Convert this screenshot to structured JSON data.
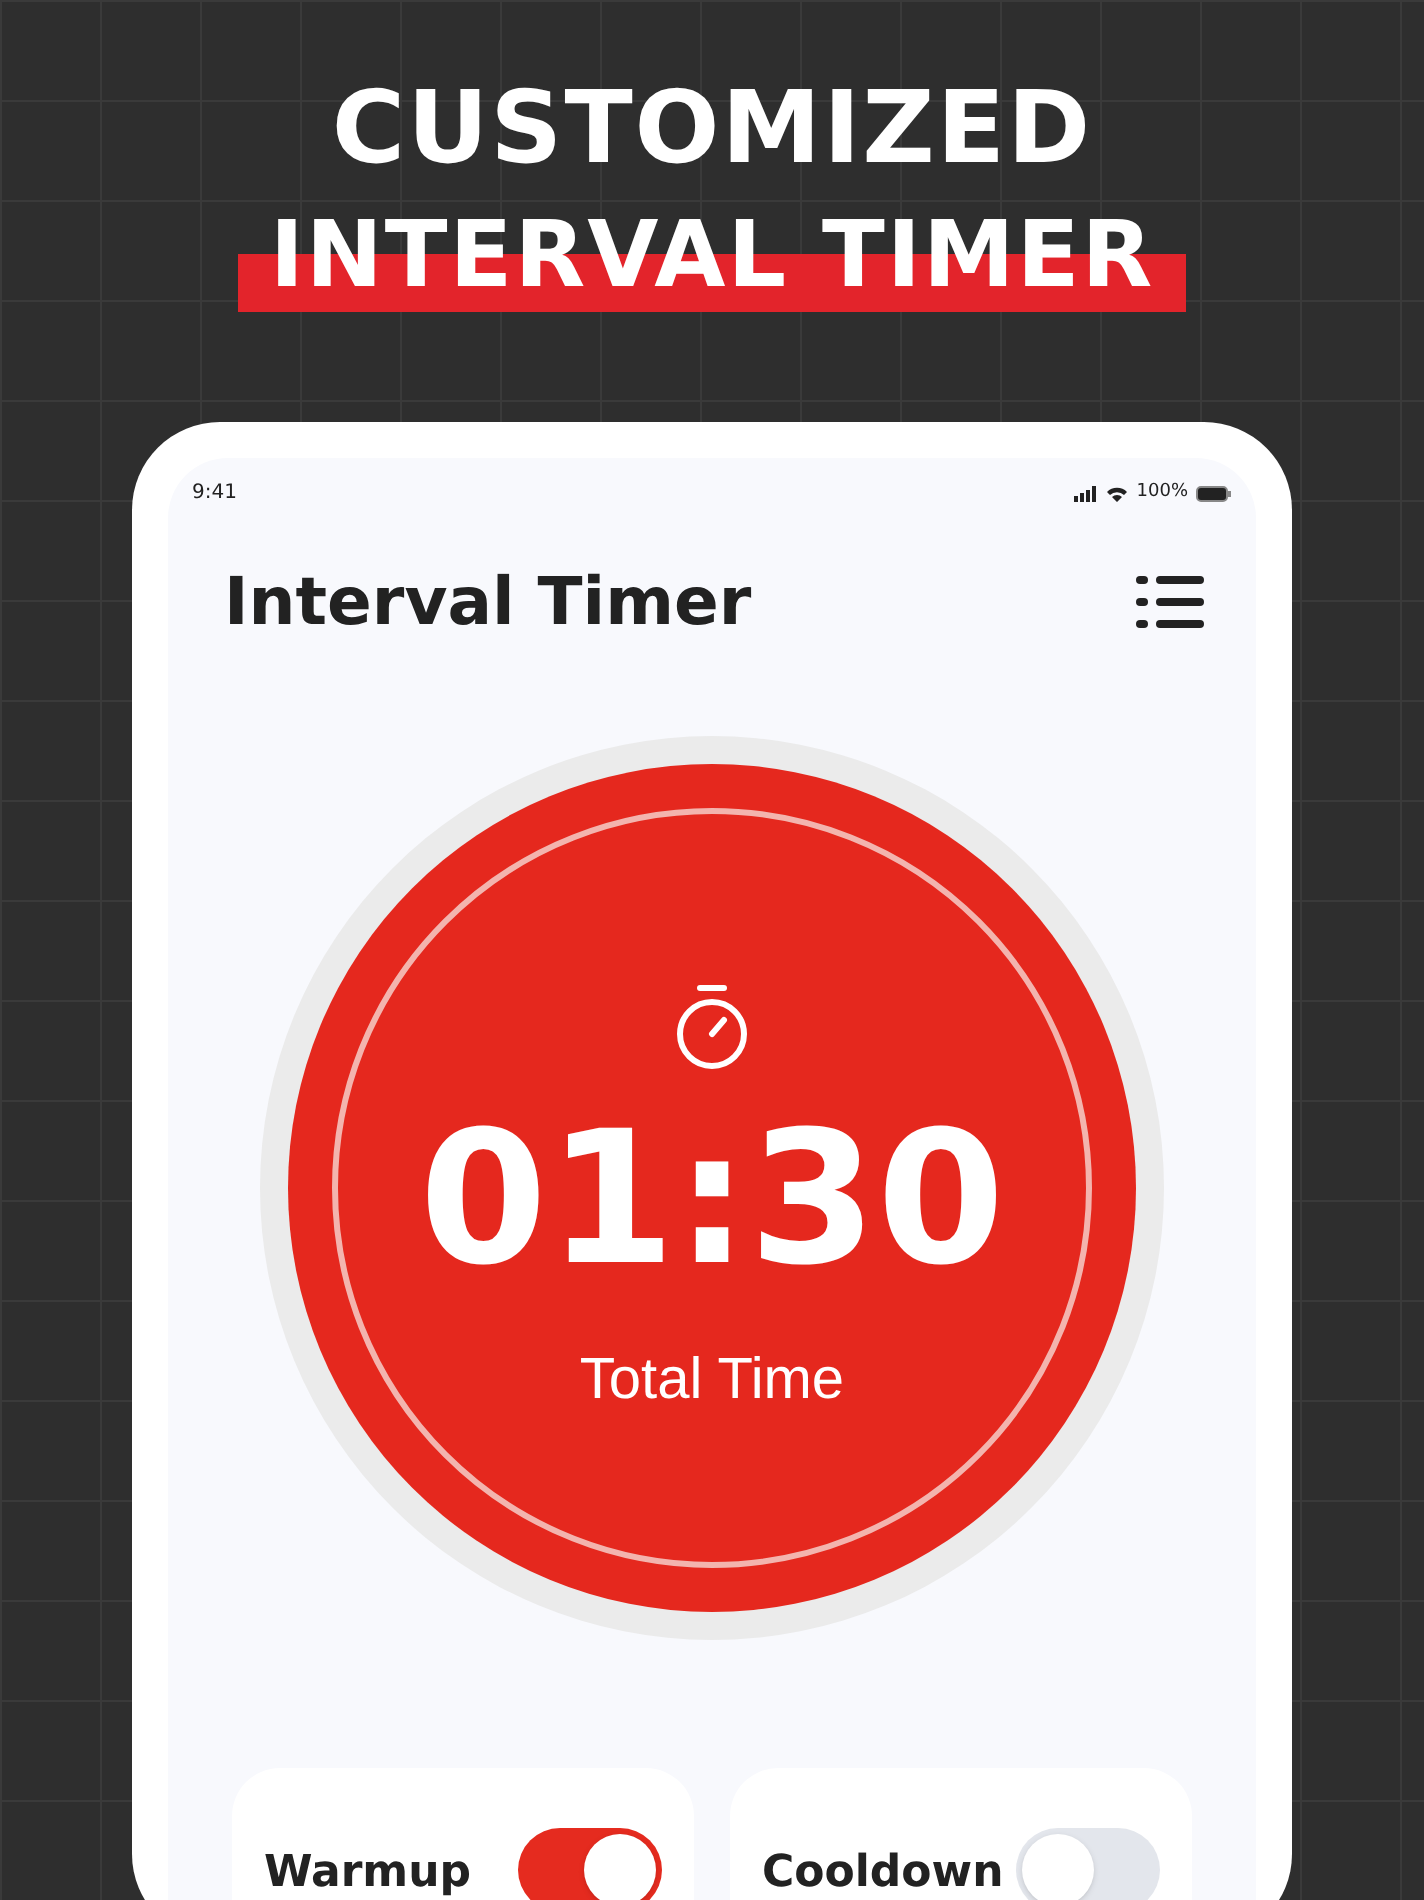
{
  "headline": {
    "line_1": "CUSTOMIZED",
    "line_2": "INTERVAL TIMER"
  },
  "status_bar": {
    "time": "9:41",
    "battery": "100%"
  },
  "header": {
    "title": "Interval Timer"
  },
  "timer": {
    "time": "01:30",
    "label": "Total Time"
  },
  "options": [
    {
      "label": "Warmup",
      "on": true
    },
    {
      "label": "Cooldown",
      "on": false
    }
  ]
}
